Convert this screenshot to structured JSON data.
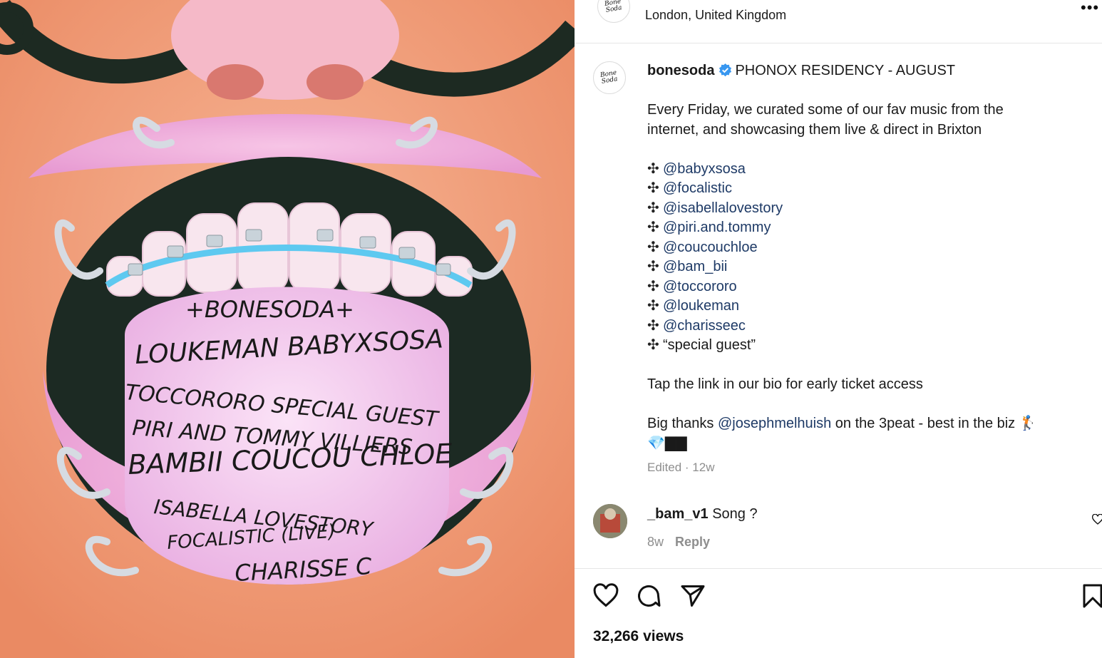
{
  "header": {
    "location": "London, United Kingdom",
    "more_label": "•••"
  },
  "post": {
    "username": "bonesoda",
    "title": "PHONOX RESIDENCY - AUGUST",
    "intro_line1": "Every Friday, we curated some of our fav music from the",
    "intro_line2": "internet, and showcasing them live & direct in Brixton",
    "bullet_symbol": "✣",
    "mentions": [
      "@babyxsosa",
      "@focalistic",
      "@isabellalovestory",
      "@piri.and.tommy",
      "@coucouchloe",
      "@bam_bii",
      "@toccororo",
      "@loukeman",
      "@charisseec"
    ],
    "special_guest": "“special guest”",
    "bio_line": "Tap the link in our bio for early ticket access",
    "thanks_prefix": "Big thanks ",
    "thanks_mention": "@josephmelhuish",
    "thanks_suffix": " on the 3peat - best in the biz 🏌",
    "thanks_emoji": "💎▇▇",
    "edited": "Edited · 12w"
  },
  "comment": {
    "username": "_bam_v1",
    "text": "Song ?",
    "age": "8w",
    "reply_label": "Reply"
  },
  "stats": {
    "views": "32,266 views"
  },
  "flyer": {
    "brand": "+BONESODA+",
    "lines": [
      "LOUKEMAN  BABYXSOSA",
      "TOCCORORO  SPECIAL GUEST",
      "PIRI AND TOMMY VILLIERS",
      "BAMBII COUCOU CHLOE",
      "ISABELLA LOVESTORY",
      "FOCALISTIC (LIVE)",
      "CHARISSE C"
    ]
  },
  "colors": {
    "verified": "#3897f0",
    "mention": "#1e3a66",
    "skin": "#f3a27f",
    "tongue": "#f4c8ee"
  },
  "icons": {
    "like": "heart-icon",
    "comment": "comment-bubble-icon",
    "share": "paper-plane-icon",
    "save": "bookmark-icon",
    "verified": "verified-badge-icon"
  }
}
